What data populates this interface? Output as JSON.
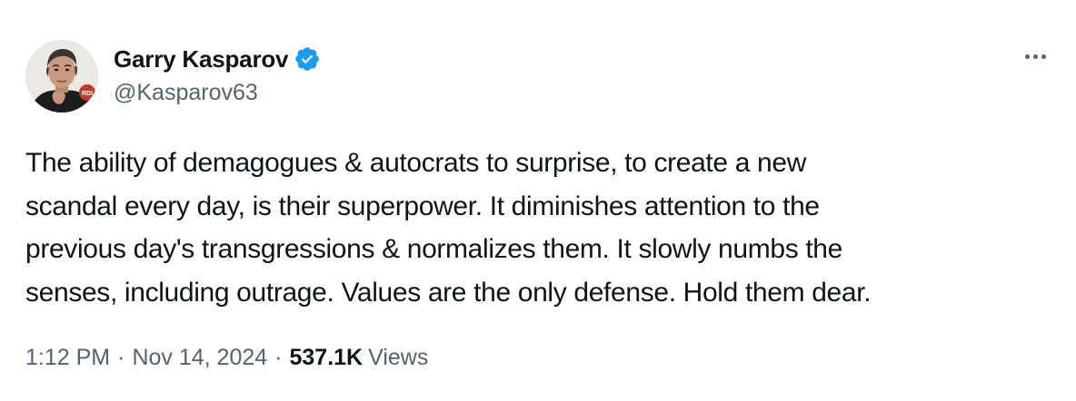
{
  "author": {
    "display_name": "Garry Kasparov",
    "handle": "@Kasparov63",
    "verified": true,
    "avatar_badge_text": "RDI"
  },
  "tweet": {
    "text": "The ability of demagogues & autocrats to surprise, to create a new\nscandal every day, is their superpower. It diminishes attention to the\nprevious day's transgressions & normalizes them. It slowly numbs the\nsenses, including outrage. Values are the only defense. Hold them dear.",
    "time": "1:12 PM",
    "date": "Nov 14, 2024",
    "separator": "·",
    "views_count": "537.1K",
    "views_label": "Views"
  },
  "icons": {
    "verified": "verified-badge-icon",
    "more": "more-options-icon"
  },
  "colors": {
    "text_primary": "#0f1419",
    "text_secondary": "#536471",
    "verified_blue": "#1d9bf0",
    "background": "#ffffff"
  }
}
